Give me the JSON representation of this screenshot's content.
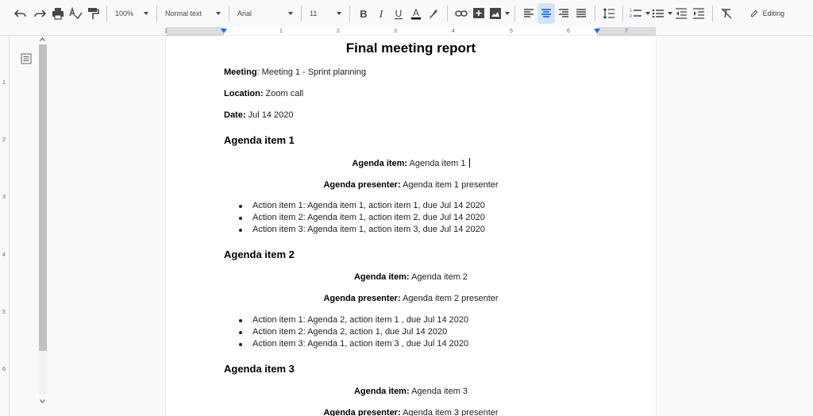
{
  "toolbar": {
    "zoom": "100%",
    "style": "Normal text",
    "font": "Arial",
    "size": "11",
    "mode": "Editing"
  },
  "ruler": {
    "numbers": [
      "1",
      "1",
      "2",
      "3",
      "4",
      "5",
      "6",
      "7"
    ]
  },
  "vruler": {
    "numbers": [
      "1",
      "2",
      "3",
      "4",
      "5",
      "6"
    ]
  },
  "document": {
    "title": "Final meeting report",
    "meeting_label": "Meeting",
    "meeting_value": ": Meeting 1 - Sprint planning",
    "location_label": "Location:",
    "location_value": " Zoom call",
    "date_label": "Date:",
    "date_value": " Jul 14 2020",
    "sections": [
      {
        "heading": "Agenda item 1",
        "item_label": "Agenda item:",
        "item_value": " Agenda item 1",
        "presenter_label": "Agenda presenter:",
        "presenter_value": " Agenda item 1 presenter",
        "actions": [
          "Action item 1: Agenda item 1, action item 1, due Jul 14 2020",
          "Action item 2: Agenda item 1, action item 2, due Jul 14 2020",
          "Action item 3: Agenda item 1, action item 3, due Jul 14 2020"
        ]
      },
      {
        "heading": "Agenda item 2",
        "item_label": "Agenda item:",
        "item_value": " Agenda item 2",
        "presenter_label": "Agenda presenter:",
        "presenter_value": " Agenda item 2 presenter",
        "actions": [
          "Action item 1: Agenda 2, action item 1 , due Jul 14 2020",
          "Action item 2:  Agenda 2, action 1, due Jul 14 2020",
          "Action item 3: Agenda 1, action item 3 , due Jul 14 2020"
        ]
      },
      {
        "heading": "Agenda item 3",
        "item_label": "Agenda item:",
        "item_value": " Agenda item 3",
        "presenter_label": "Agenda presenter:",
        "presenter_value": " Agenda item 3 presenter"
      }
    ]
  }
}
